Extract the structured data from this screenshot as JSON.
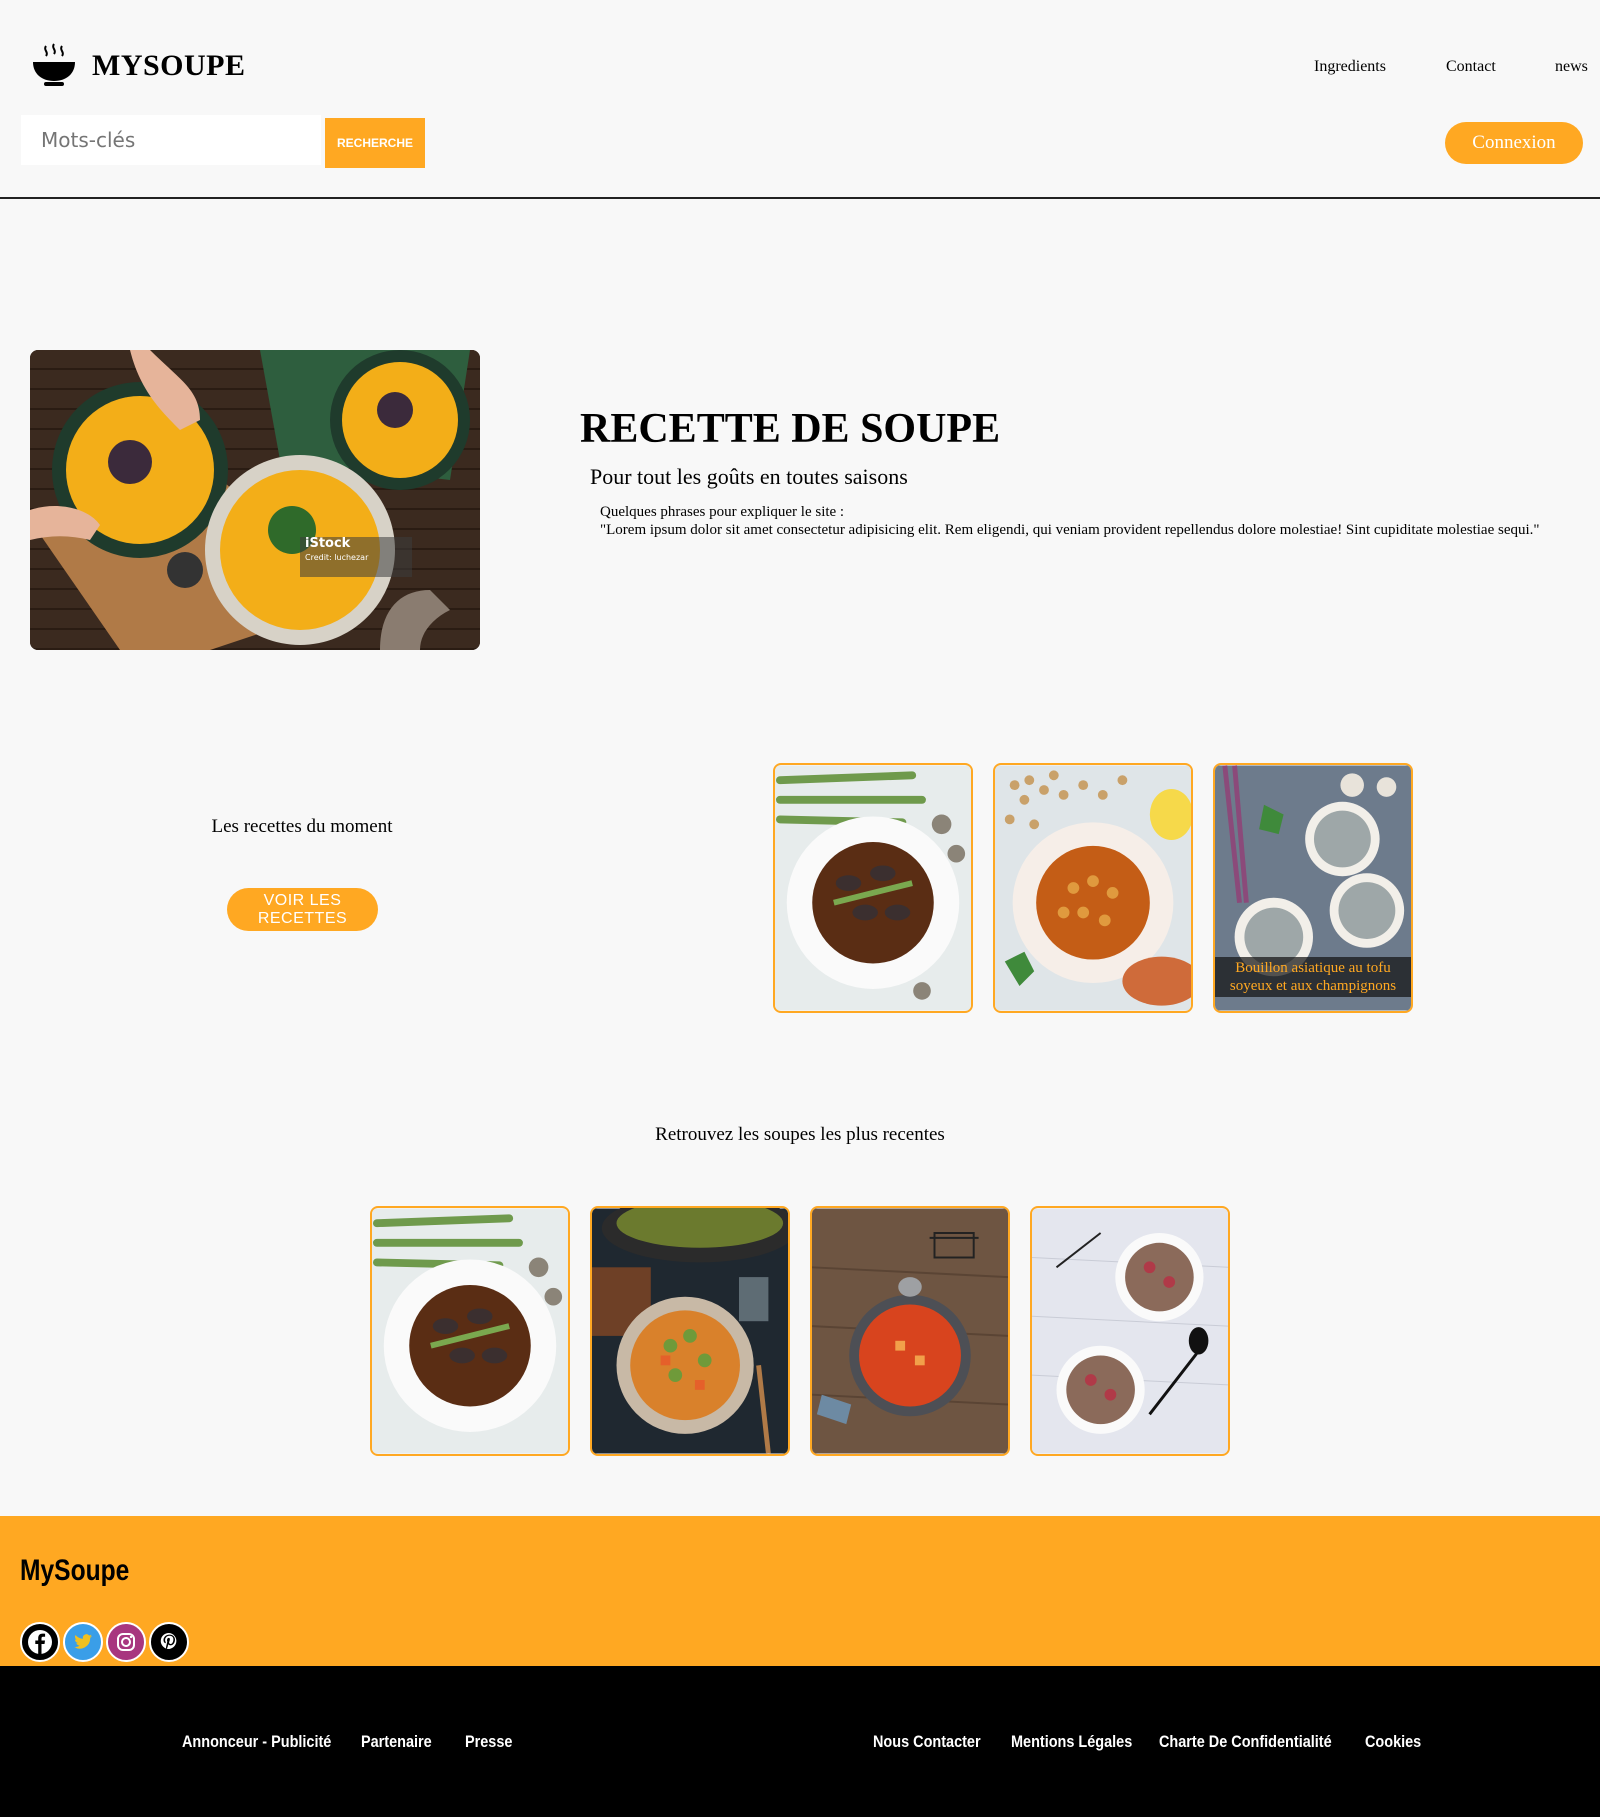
{
  "header": {
    "logo_text": "MYSOUPE",
    "nav": [
      "Ingredients",
      "Contact",
      "news"
    ],
    "search_placeholder": "Mots-clés",
    "search_button": "RECHERCHE",
    "login_button": "Connexion"
  },
  "hero": {
    "image_watermark": "iStock",
    "image_credit": "Credit: luchezar",
    "title": "RECETTE DE SOUPE",
    "subtitle": "Pour tout les goûts en toutes saisons",
    "intro": "Quelques phrases pour expliquer le site :",
    "lorem": "\"Lorem ipsum dolor sit amet consectetur adipisicing elit. Rem eligendi, qui veniam provident repellendus dolore molestiae! Sint cupiditate molestiae sequi.\""
  },
  "moment": {
    "title": "Les recettes du moment",
    "button": "VOIR LES RECETTES",
    "cards": [
      {
        "caption": ""
      },
      {
        "caption": ""
      },
      {
        "caption": "Bouillon asiatique au tofu soyeux et aux champignons"
      }
    ]
  },
  "recent": {
    "title": "Retrouvez les soupes les plus recentes"
  },
  "footer": {
    "brand": "MySoupe",
    "social_icons": [
      "facebook-icon",
      "twitter-icon",
      "instagram-icon",
      "pinterest-icon"
    ],
    "links_left": [
      "Annonceur - Publicité",
      "Partenaire",
      "Presse"
    ],
    "links_right": [
      "Nous Contacter",
      "Mentions Légales",
      "Charte De Confidentialité",
      "Cookies"
    ]
  },
  "colors": {
    "accent": "#ffa822",
    "background": "#f8f8f8",
    "footer_dark": "#000000"
  }
}
